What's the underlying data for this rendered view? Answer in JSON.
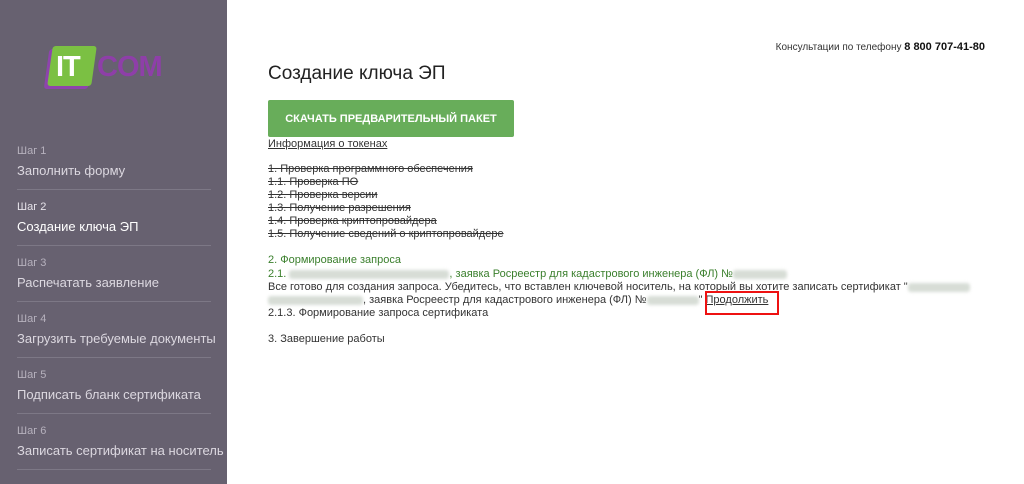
{
  "logo": {
    "it": "IT",
    "com": "COM"
  },
  "steps": [
    {
      "num": "Шаг 1",
      "label": "Заполнить форму"
    },
    {
      "num": "Шаг 2",
      "label": "Создание ключа ЭП"
    },
    {
      "num": "Шаг 3",
      "label": "Распечатать заявление"
    },
    {
      "num": "Шаг 4",
      "label": "Загрузить требуемые документы"
    },
    {
      "num": "Шаг 5",
      "label": "Подписать бланк сертификата"
    },
    {
      "num": "Шаг 6",
      "label": "Записать сертификат на носитель"
    }
  ],
  "header": {
    "phone_label": "Консультации по телефону",
    "phone_number": "8 800 707-41-80"
  },
  "main": {
    "title": "Создание ключа ЭП",
    "download_button": "Скачать предварительный пакет",
    "tokens_link": "Информация о токенах",
    "check_list": [
      "1. Проверка программного обеспечения",
      "1.1. Проверка ПО",
      "1.2. Проверка версии",
      "1.3. Получение разрешения",
      "1.4. Проверка криптопровайдера",
      "1.5. Получение сведений о криптопровайдере"
    ],
    "section2_title": "2. Формирование запроса",
    "line_21_prefix": "2.1.",
    "line_21_text": ", заявка Росреестр для кадастрового инженера (ФЛ) №",
    "ready_text_1": "Все готово для создания запроса. Убедитесь, что вставлен ключевой носитель, на который вы хотите записать сертификат \"",
    "ready_text_2": ", заявка Росреестр для кадастрового инженера (ФЛ) №",
    "ready_quote": "\"",
    "continue_link": "Продолжить",
    "line_213": "2.1.3. Формирование запроса сертификата",
    "section3_title": "3. Завершение работы"
  },
  "colors": {
    "sidebar_bg": "#676170",
    "button_green": "#68ad5a",
    "link_green": "#3a7f2c",
    "highlight_red": "#ee1111",
    "logo_green": "#7bc043",
    "logo_purple": "#8e3fa8"
  }
}
